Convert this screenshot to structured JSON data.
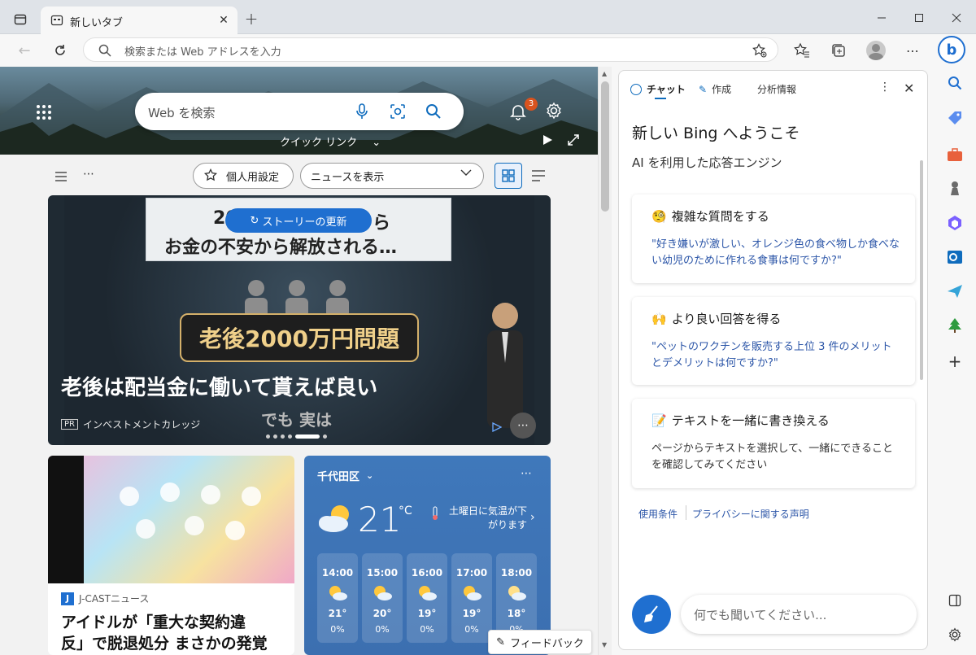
{
  "browser": {
    "tab_title": "新しいタブ",
    "new_tab_symbol": "+",
    "omnibox_placeholder": "検索または Web アドレスを入力",
    "window_controls": [
      "minimize-icon",
      "maximize-icon",
      "close-icon"
    ]
  },
  "ntp": {
    "search_placeholder": "Web を検索",
    "notification_count": "3",
    "quick_links_label": "クイック リンク",
    "personalize_label": "個人用設定",
    "news_select": "ニュースを表示",
    "story_update_label": "ストーリーの更新",
    "hero_card": {
      "image_caption_top": "2030年 … お金の不安から解放される…",
      "image_caption_line1": "お金の不安から解放される…",
      "image_caption_prefix": "20",
      "image_caption_suffix": "ら",
      "image_banner": "老後2000万円問題",
      "image_subtext": "でも 実は",
      "headline": "老後は配当金に働いて貰えば良い",
      "source_badge": "PR",
      "source": "インベストメントカレッジ"
    },
    "news_card": {
      "source_badge": "J",
      "source": "J-CASTニュース",
      "headline_line1": "アイドルが「重大な契約違",
      "headline_line2": "反」で脱退処分 まさかの発覚"
    },
    "weather": {
      "location": "千代田区",
      "temperature": "21",
      "unit": "°C",
      "alert": "土曜日に気温が下がります",
      "hours": [
        {
          "time": "14:00",
          "temp": "21°",
          "precip": "0%"
        },
        {
          "time": "15:00",
          "temp": "20°",
          "precip": "0%"
        },
        {
          "time": "16:00",
          "temp": "19°",
          "precip": "0%"
        },
        {
          "time": "17:00",
          "temp": "19°",
          "precip": "0%"
        },
        {
          "time": "18:00",
          "temp": "18°",
          "precip": "0%"
        }
      ]
    },
    "feedback_label": "フィードバック"
  },
  "bing": {
    "tabs": [
      "チャット",
      "作成",
      "分析情報"
    ],
    "title": "新しい Bing へようこそ",
    "subtitle": "AI を利用した応答エンジン",
    "cards": [
      {
        "emoji": "🧐",
        "title": "複雑な質問をする",
        "body": "\"好き嫌いが激しい、オレンジ色の食べ物しか食べない幼児のために作れる食事は何ですか?\"",
        "style": "link"
      },
      {
        "emoji": "🙌",
        "title": "より良い回答を得る",
        "body": "\"ペットのワクチンを販売する上位 3 件のメリットとデメリットは何ですか?\"",
        "style": "link"
      },
      {
        "emoji": "📝",
        "title": "テキストを一緒に書き換える",
        "body": "ページからテキストを選択して、一緒にできることを確認してみてください",
        "style": "plain"
      }
    ],
    "terms": "使用条件",
    "privacy": "プライバシーに関する声明",
    "input_placeholder": "何でも聞いてください..."
  },
  "colors": {
    "accent_blue": "#0f6cbd",
    "link_blue": "#2c56a8",
    "badge_orange": "#d9531e"
  }
}
